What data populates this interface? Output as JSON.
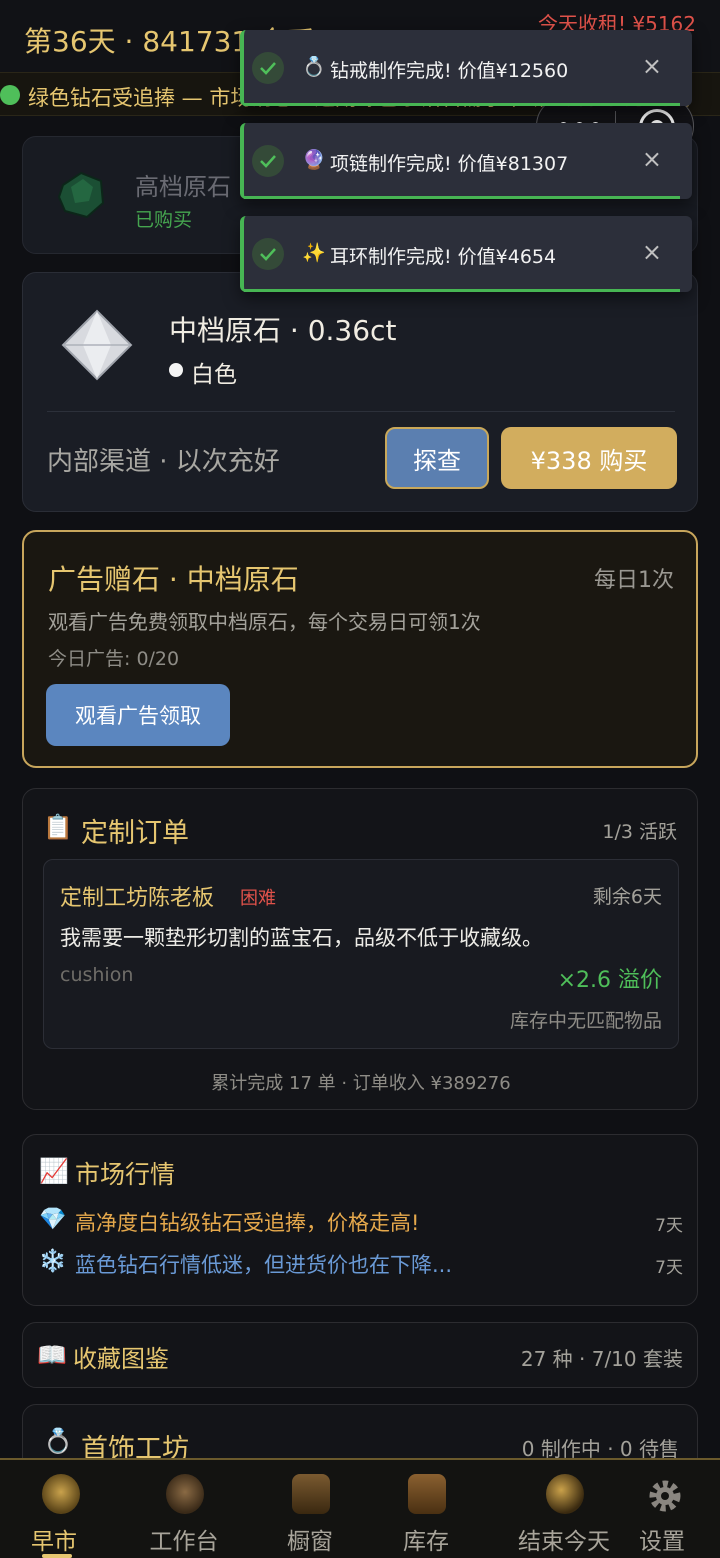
{
  "header": {
    "day_text": "第36天 · 841731 金币",
    "rent_text": "今天收租! ¥5162"
  },
  "ticker": {
    "text": "绿色钻石受追捧 — 市场消息：近期绿色系钻石需求不断上升，买家纷纷"
  },
  "stone_bought": {
    "title": "高档原石",
    "status": "已购买"
  },
  "stone_offer": {
    "title": "中档原石 · 0.36ct",
    "color": "白色",
    "channel": "内部渠道 · 以次充好",
    "probe_label": "探查",
    "buy_label": "¥338 购买"
  },
  "ad_gift": {
    "title": "广告赠石 · 中档原石",
    "limit": "每日1次",
    "desc": "观看广告免费领取中档原石，每个交易日可领1次",
    "count": "今日广告: 0/20",
    "button_label": "观看广告领取"
  },
  "custom_orders": {
    "icon": "📋",
    "title": "定制订单",
    "active": "1/3 活跃",
    "order": {
      "client": "定制工坊陈老板",
      "difficulty": "困难",
      "remaining": "剩余6天",
      "request": "我需要一颗垫形切割的蓝宝石，品级不低于收藏级。",
      "shape": "cushion",
      "premium": "×2.6 溢价",
      "match_status": "库存中无匹配物品"
    },
    "summary": "累计完成 17 单 · 订单收入 ¥389276"
  },
  "market": {
    "icon": "📈",
    "title": "市场行情",
    "news": [
      {
        "icon": "💎",
        "text": "高净度白钻级钻石受追捧，价格走高!",
        "age": "7天",
        "color": "#e6a94c"
      },
      {
        "icon": "❄️",
        "text": "蓝色钻石行情低迷，但进货价也在下降...",
        "age": "7天",
        "color": "#6a9ad6"
      }
    ]
  },
  "collection": {
    "icon": "📖",
    "title": "收藏图鉴",
    "meta": "27 种 · 7/10 套装"
  },
  "workshop": {
    "icon": "💍",
    "title": "首饰工坊",
    "meta": "0 制作中 · 0 待售"
  },
  "toasts": [
    {
      "icon": "💍",
      "message": "钻戒制作完成! 价值¥12560"
    },
    {
      "icon": "🔮",
      "message": "项链制作完成! 价值¥81307"
    },
    {
      "icon": "✨",
      "message": "耳环制作完成! 价值¥4654"
    }
  ],
  "toast_close": "×",
  "nav": [
    {
      "label": "早市",
      "icon": "market-icon"
    },
    {
      "label": "工作台",
      "icon": "workbench-icon"
    },
    {
      "label": "橱窗",
      "icon": "showcase-icon"
    },
    {
      "label": "库存",
      "icon": "inventory-icon"
    },
    {
      "label": "结束今天",
      "icon": "moon-icon"
    },
    {
      "label": "设置",
      "icon": "gear-icon"
    }
  ],
  "colors": {
    "gold": "#e6c670",
    "green": "#4fbf5a",
    "red": "#e0524a",
    "blue_button": "#5b86bf"
  }
}
